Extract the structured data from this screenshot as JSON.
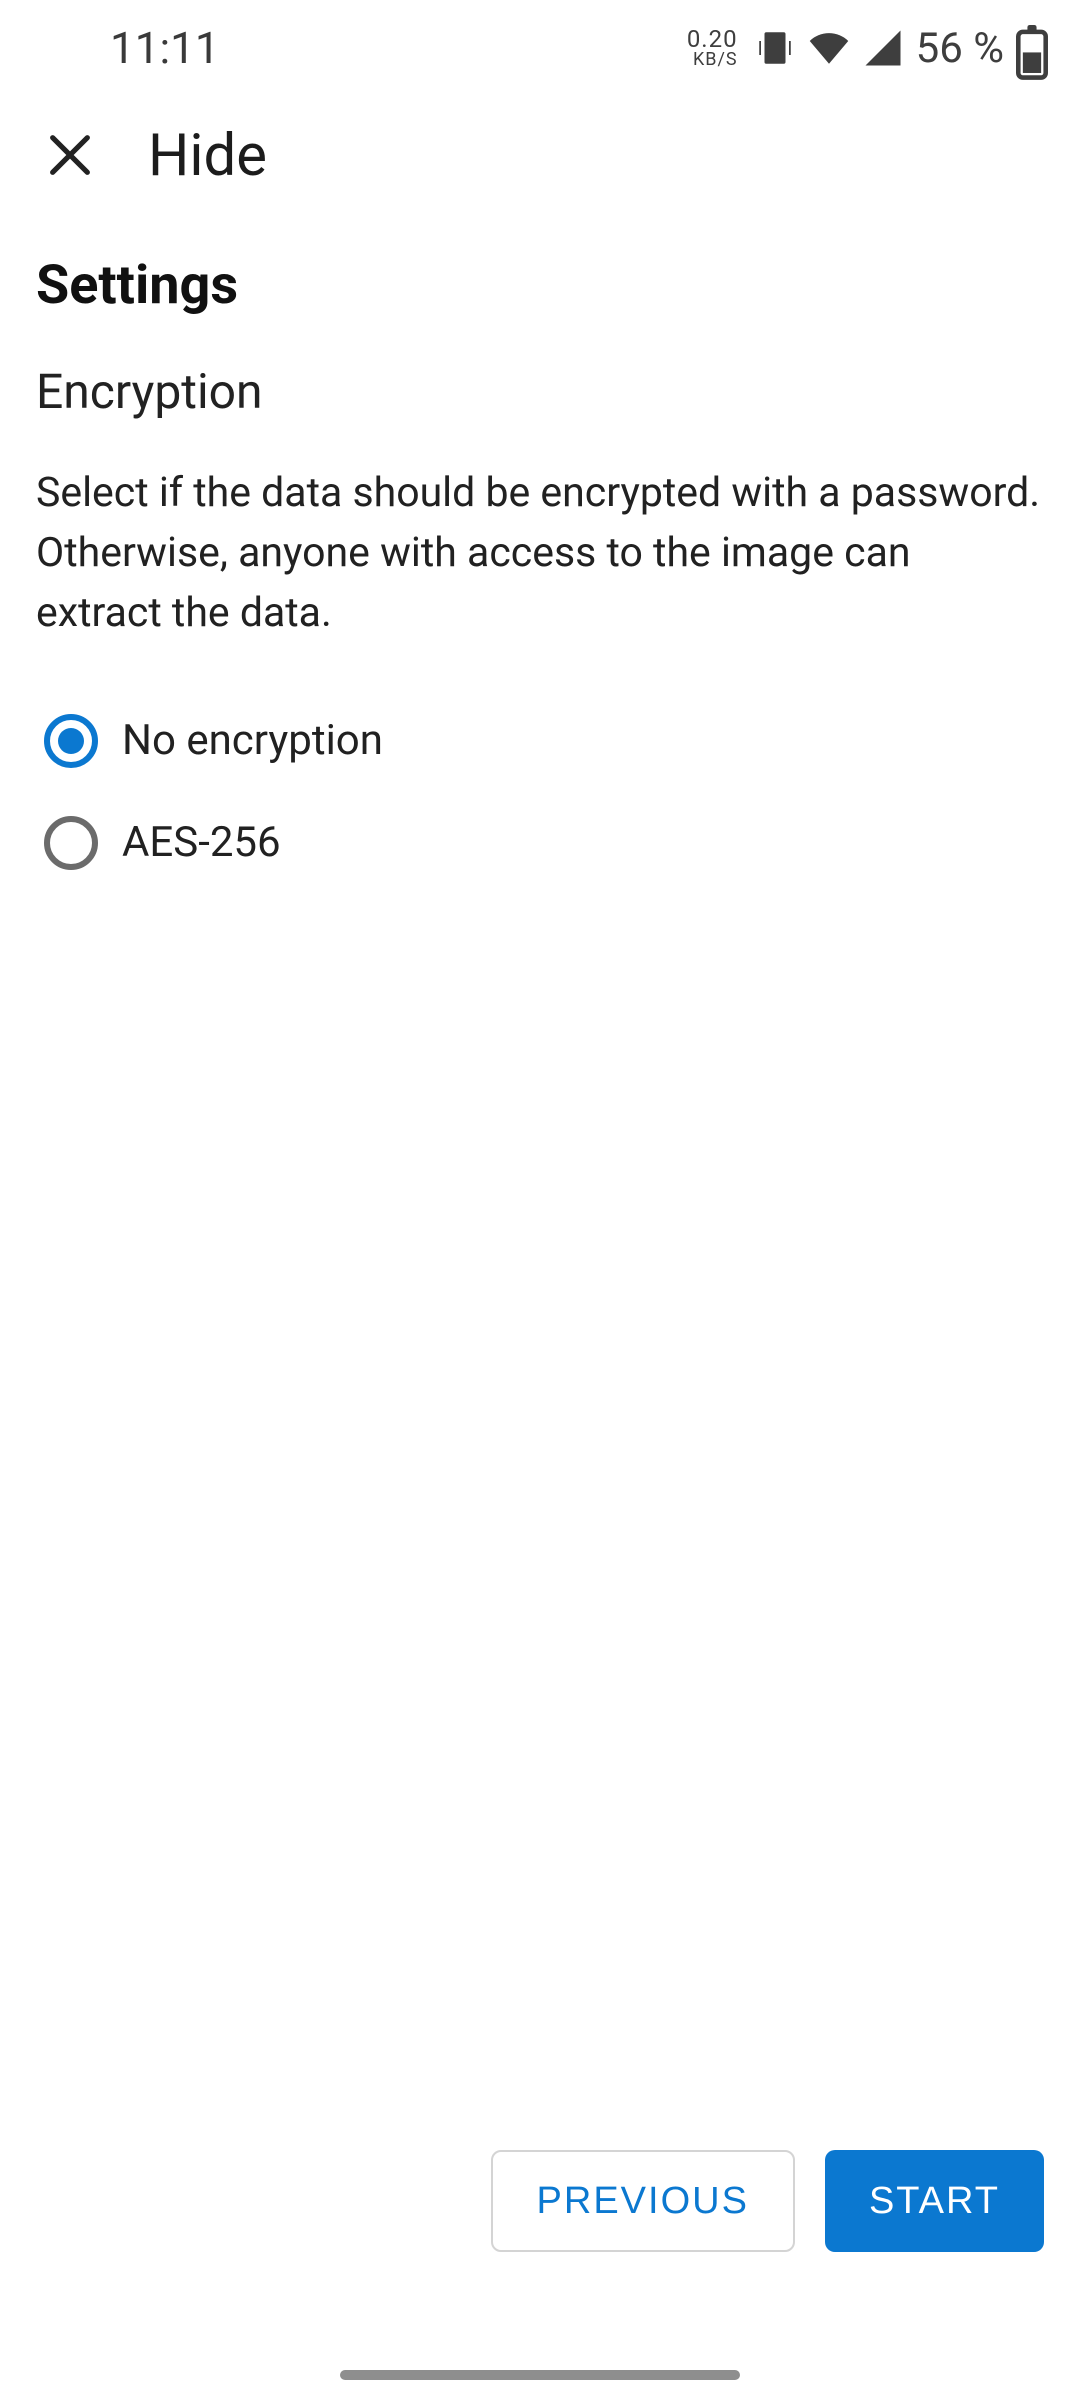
{
  "status_bar": {
    "time": "11:11",
    "net_speed_value": "0.20",
    "net_speed_unit": "KB/S",
    "battery_percent": "56 %"
  },
  "app_bar": {
    "title": "Hide"
  },
  "headings": {
    "settings": "Settings",
    "encryption": "Encryption"
  },
  "description": "Select if the data should be encrypted with a password. Otherwise, anyone with access to the image can extract the data.",
  "options": [
    {
      "label": "No encryption",
      "selected": true
    },
    {
      "label": "AES-256",
      "selected": false
    }
  ],
  "buttons": {
    "previous": "PREVIOUS",
    "start": "START"
  }
}
